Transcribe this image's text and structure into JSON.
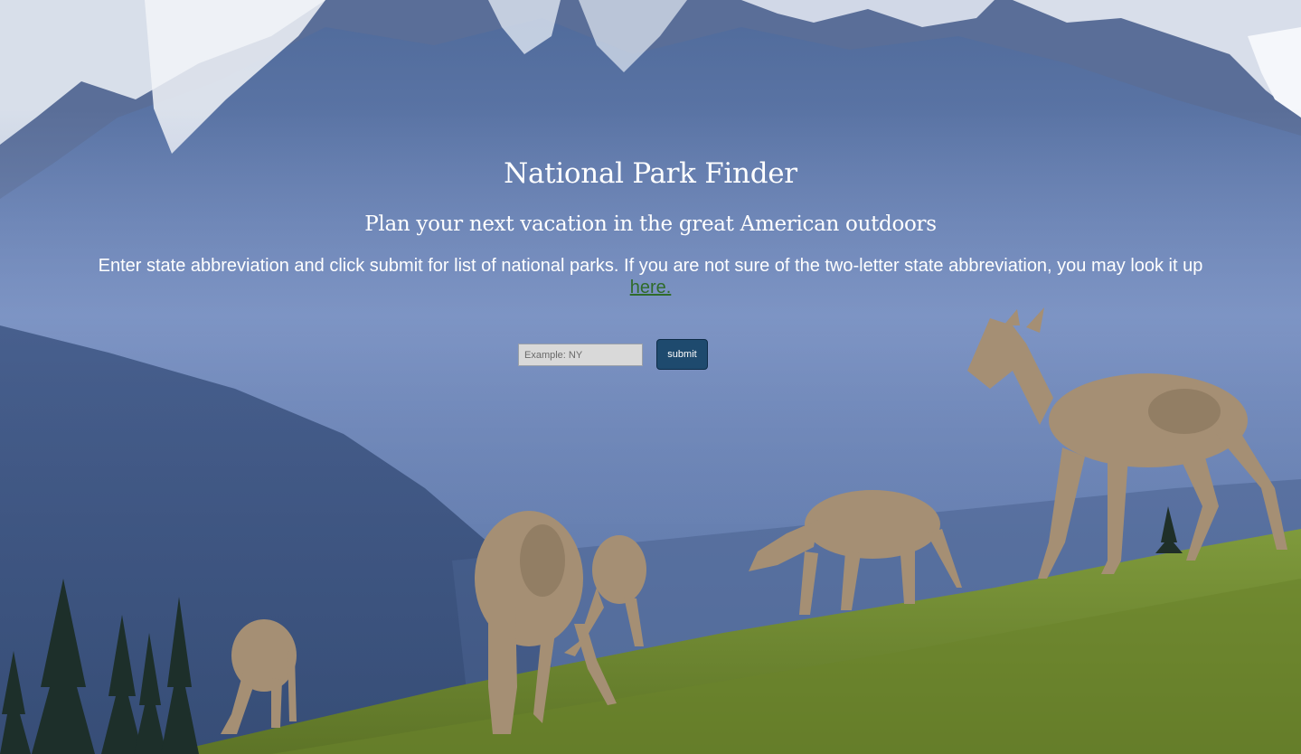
{
  "page": {
    "title": "National Park Finder",
    "subtitle": "Plan your next vacation in the great American outdoors",
    "instructions": "Enter state abbreviation and click submit for list of national parks. If you are not sure of the two-letter state abbreviation, you may look it up",
    "lookup_link_label": "here."
  },
  "search": {
    "placeholder": "Example: NY",
    "value": "",
    "submit_label": "submit"
  },
  "colors": {
    "link": "#2f6b2a",
    "button": "#1e4a6e",
    "input_bg": "#d9d9d9"
  }
}
